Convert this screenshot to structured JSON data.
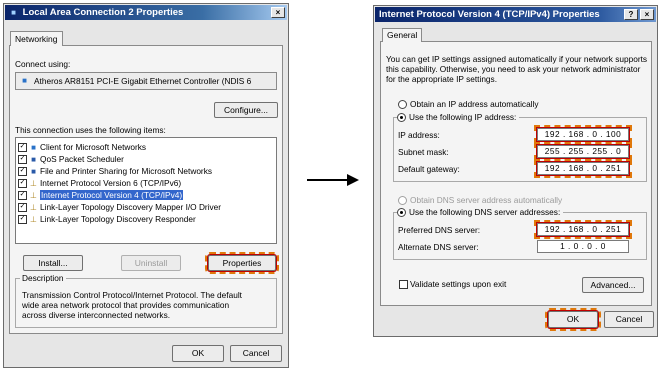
{
  "left_window": {
    "title": "Local Area Connection 2 Properties",
    "close_glyph": "×",
    "tab": "Networking",
    "connect_using_label": "Connect using:",
    "adapter": "Atheros AR8151 PCI-E Gigabit Ethernet Controller (NDIS 6",
    "configure_button": "Configure...",
    "items_label": "This connection uses the following items:",
    "items": [
      {
        "label": "Client for Microsoft Networks",
        "icon": "network-client-icon",
        "checked": true
      },
      {
        "label": "QoS Packet Scheduler",
        "icon": "network-service-icon",
        "checked": true
      },
      {
        "label": "File and Printer Sharing for Microsoft Networks",
        "icon": "network-service-icon",
        "checked": true
      },
      {
        "label": "Internet Protocol Version 6 (TCP/IPv6)",
        "icon": "protocol-icon",
        "checked": true
      },
      {
        "label": "Internet Protocol Version 4 (TCP/IPv4)",
        "icon": "protocol-icon",
        "checked": true,
        "selected": true
      },
      {
        "label": "Link-Layer Topology Discovery Mapper I/O Driver",
        "icon": "protocol-icon",
        "checked": true
      },
      {
        "label": "Link-Layer Topology Discovery Responder",
        "icon": "protocol-icon",
        "checked": true
      }
    ],
    "install_button": "Install...",
    "uninstall_button": "Uninstall",
    "properties_button": "Properties",
    "description_label": "Description",
    "description_lines": [
      "Transmission Control Protocol/Internet Protocol. The default",
      "wide area network protocol that provides communication",
      "across diverse interconnected networks."
    ],
    "ok_button": "OK",
    "cancel_button": "Cancel"
  },
  "right_window": {
    "title": "Internet Protocol Version 4 (TCP/IPv4) Properties",
    "help_glyph": "?",
    "close_glyph": "×",
    "tab": "General",
    "intro_lines": [
      "You can get IP settings assigned automatically if your network supports",
      "this capability. Otherwise, you need to ask your network administrator",
      "for the appropriate IP settings."
    ],
    "obtain_ip_auto": "Obtain an IP address automatically",
    "use_following_ip": "Use the following IP address:",
    "ip_address_label": "IP address:",
    "ip_address": "192 . 168 .  0  . 100",
    "subnet_label": "Subnet mask:",
    "subnet": "255 . 255 . 255 .  0",
    "gateway_label": "Default gateway:",
    "gateway": "192 . 168 .  0  . 251",
    "obtain_dns_auto": "Obtain DNS server address automatically",
    "use_following_dns": "Use the following DNS server addresses:",
    "preferred_dns_label": "Preferred DNS server:",
    "preferred_dns": "192 . 168 .  0  . 251",
    "alternate_dns_label": "Alternate DNS server:",
    "alternate_dns": "1  .  0  .  0  .  0",
    "validate_label": "Validate settings upon exit",
    "advanced_button": "Advanced...",
    "ok_button": "OK",
    "cancel_button": "Cancel"
  },
  "colors": {
    "highlight_border": "#e0780a",
    "selection": "#3366cc",
    "title_bar": "#0a246a"
  }
}
